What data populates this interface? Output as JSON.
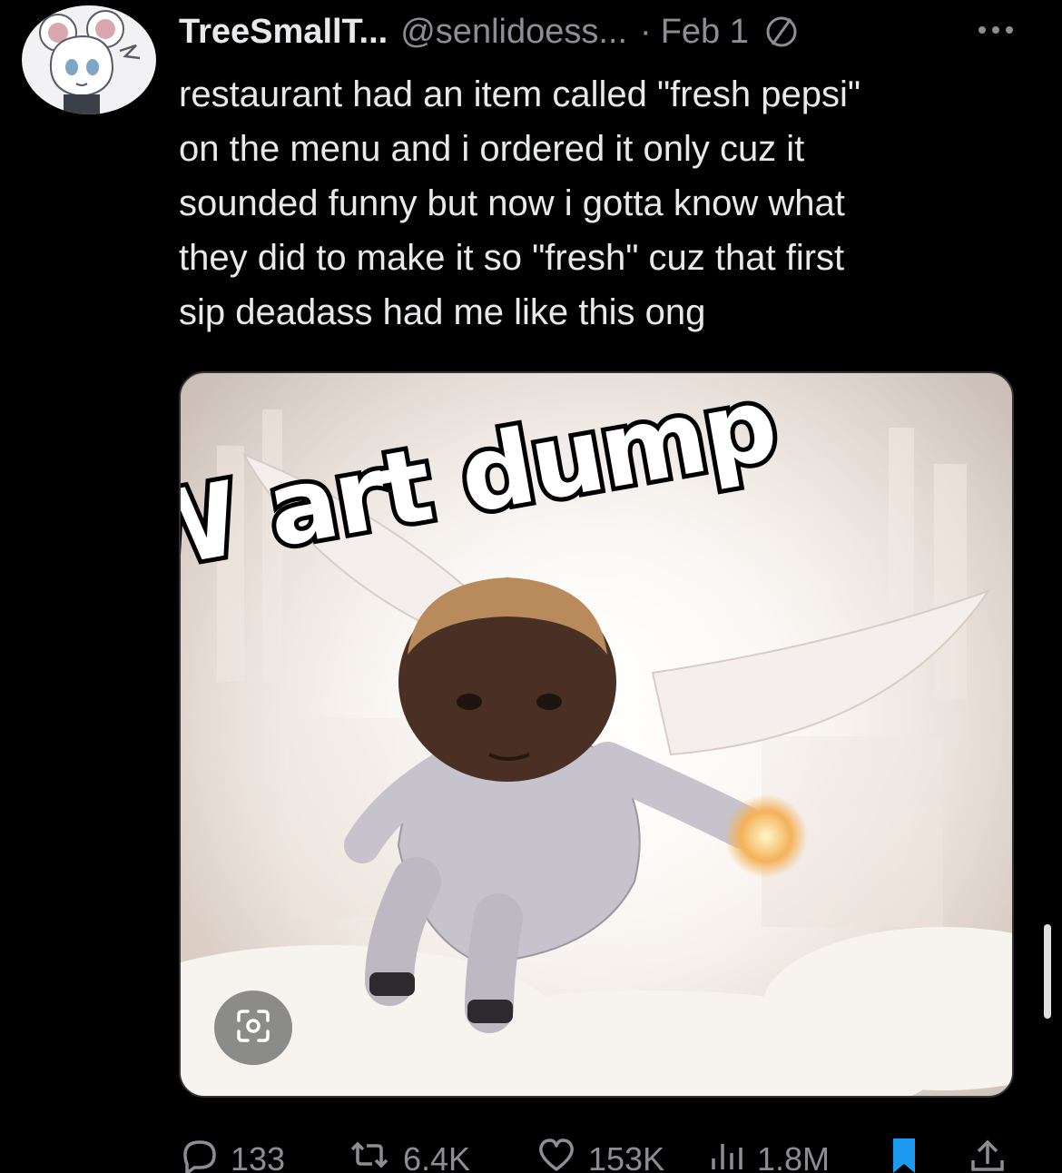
{
  "tweet": {
    "display_name": "TreeSmallT...",
    "handle": "@senlidoess...",
    "separator": "·",
    "date": "Feb 1",
    "text": "restaurant had an item called \"fresh pepsi\"\non the menu and i ordered it only cuz it\nsounded funny but now i gotta know what\nthey did to make it so \"fresh\" cuz that first\nsip deadass had me like this ong",
    "media_caption": "W art dump"
  },
  "actions": {
    "replies": "133",
    "reposts": "6.4K",
    "likes": "153K",
    "views": "1.8M"
  },
  "icons": {
    "circle_slash": "circle-slash-icon",
    "more": "more-icon",
    "reply": "reply-icon",
    "repost": "repost-icon",
    "like": "heart-icon",
    "views": "views-icon",
    "bookmark": "bookmark-icon",
    "share": "share-icon",
    "scan": "scan-icon"
  },
  "colors": {
    "background": "#000000",
    "text": "#e7e9ea",
    "secondary": "#8b8f94",
    "bookmark": "#1d9bf0"
  }
}
